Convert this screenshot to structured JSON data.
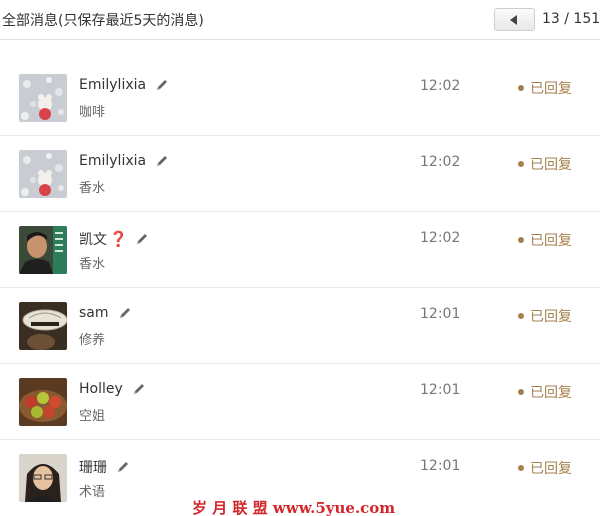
{
  "header": {
    "title": "全部消息(只保存最近5天的消息)",
    "pager": "13 / 151"
  },
  "messages": [
    {
      "name": "Emilylixia",
      "question_mark": "",
      "subtitle": "咖啡",
      "time": "12:02",
      "status": "已回复",
      "avatar": "teddy-bear-snow"
    },
    {
      "name": "Emilylixia",
      "question_mark": "",
      "subtitle": "香水",
      "time": "12:02",
      "status": "已回复",
      "avatar": "teddy-bear-snow"
    },
    {
      "name": "凯文",
      "question_mark": "❓",
      "subtitle": "香水",
      "time": "12:02",
      "status": "已回复",
      "avatar": "man-portrait"
    },
    {
      "name": "sam",
      "question_mark": "",
      "subtitle": "修养",
      "time": "12:01",
      "status": "已回复",
      "avatar": "hat-photo"
    },
    {
      "name": "Holley",
      "question_mark": "",
      "subtitle": "空姐",
      "time": "12:01",
      "status": "已回复",
      "avatar": "fruit-bowl"
    },
    {
      "name": "珊珊",
      "question_mark": "",
      "subtitle": "术语",
      "time": "12:01",
      "status": "已回复",
      "avatar": "woman-portrait"
    }
  ],
  "watermark": "岁 月 联 盟  www.5yue.com",
  "colors": {
    "status": "#a5804d",
    "question": "#d0021b"
  }
}
